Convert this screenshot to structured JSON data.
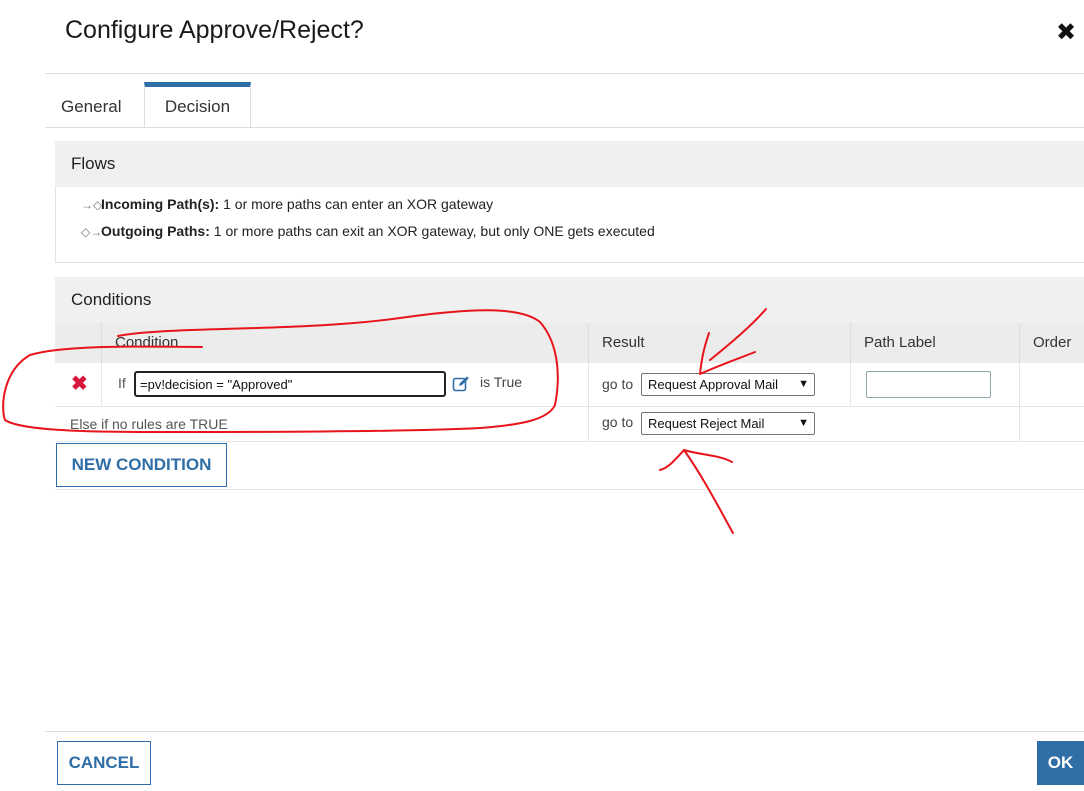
{
  "dialog": {
    "title": "Configure Approve/Reject?",
    "close_symbol": "✖"
  },
  "tabs": [
    {
      "label": "General",
      "active": false
    },
    {
      "label": "Decision",
      "active": true
    }
  ],
  "flows": {
    "header": "Flows",
    "incoming": {
      "label": "Incoming Path(s):",
      "text": "1 or more paths can enter an XOR gateway"
    },
    "outgoing": {
      "label": "Outgoing Paths:",
      "text": "1 or more paths can exit an XOR gateway, but only ONE gets executed"
    }
  },
  "conditions": {
    "header": "Conditions",
    "columns": {
      "condition": "Condition",
      "result": "Result",
      "path_label": "Path Label",
      "order": "Order"
    },
    "rows": [
      {
        "if_label": "If",
        "expression": "=pv!decision = \"Approved\"",
        "suffix": "is True",
        "goto_label": "go to",
        "target": "Request Approval Mail",
        "path_label": ""
      }
    ],
    "else_row": {
      "label": "Else if no rules are TRUE",
      "goto_label": "go to",
      "target": "Request Reject Mail"
    },
    "new_condition_label": "NEW CONDITION"
  },
  "footer": {
    "cancel_label": "CANCEL",
    "ok_label": "OK"
  },
  "colors": {
    "accent": "#2f6ea6",
    "delete": "#d8173d",
    "annotation": "#e8141b"
  }
}
